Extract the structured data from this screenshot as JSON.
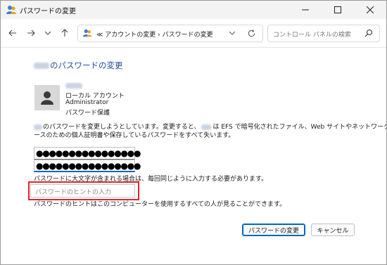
{
  "window": {
    "title": "パスワードの変更"
  },
  "nav": {
    "address": "≪  アカウントの変更  ›  パスワードの変更",
    "search_placeholder": "コントロール パネルの検索"
  },
  "content": {
    "heading": "のパスワードの変更",
    "account": {
      "type": "ローカル アカウント",
      "role": "Administrator",
      "protection": "パスワード保護"
    },
    "intro_line1_a": "のパスワードを変更しようとしています。変更すると、",
    "intro_line1_b": "は EFS で暗号化されたファイル、Web サイトやネットワーク リソ",
    "intro_line2": "ースのための個人証明書や保存しているパスワードをすべて失います。",
    "new_password_masked": "●●●●●●●●●●●●●●●●",
    "confirm_password_masked": "●●●●●●●●●●●●●●●●",
    "case_note": "パスワードに大文字が含まれる場合は、毎回同じように入力する必要があります。",
    "hint_placeholder": "パスワードのヒントの入力",
    "hint_note": "パスワードのヒントはこのコンピューターを使用するすべての人が見ることができます。"
  },
  "buttons": {
    "change": "パスワードの変更",
    "cancel": "キャンセル"
  },
  "colors": {
    "accent": "#0067c0",
    "heading": "#1f4e9e",
    "highlight": "#e0262b"
  }
}
